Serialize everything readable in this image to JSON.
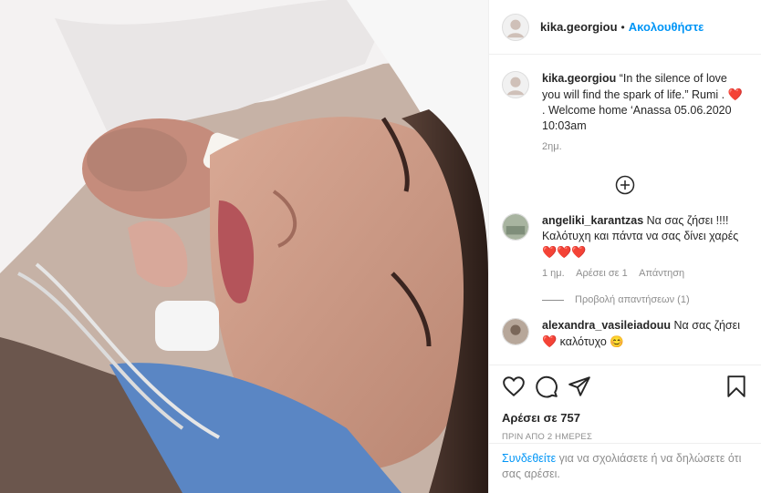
{
  "post": {
    "username": "kika.georgiou",
    "separator": "•",
    "follow_label": "Ακολουθήστε"
  },
  "caption": {
    "username": "kika.georgiou",
    "text": "“In the silence of love you will find the spark of life.” Rumi .",
    "heart": "❤️",
    "text2": ". Welcome home ‘Anassa",
    "datetime": "05.06.2020 10:03am",
    "age": "2ημ."
  },
  "comments": [
    {
      "username": "angeliki_karantzas",
      "text": "Να σας ζήσει !!!! Καλότυχη και πάντα να σας δίνει χαρές",
      "hearts": "❤️❤️❤️",
      "age": "1 ημ.",
      "likes_label": "Αρέσει σε 1",
      "reply_label": "Απάντηση",
      "view_replies": "Προβολή απαντήσεων (1)"
    },
    {
      "username": "alexandra_vasileiadouu",
      "text": "Να σας ζήσει",
      "heart": "❤️",
      "text2": "καλότυχο",
      "emoji": "😊"
    }
  ],
  "actions": {
    "likes_text": "Αρέσει σε 757",
    "timestamp": "ΠΡΙΝ ΑΠΟ 2 ΗΜΕΡΕΣ"
  },
  "footer": {
    "login_link": "Συνδεθείτε",
    "rest": " για να σχολιάσετε ή να δηλώσετε ότι σας αρέσει."
  },
  "colors": {
    "link": "#0095f6",
    "heart": "#e0101e",
    "muted": "#8e8e8e"
  },
  "icons": [
    "plus-circle-icon",
    "like-icon",
    "comment-icon",
    "share-icon",
    "bookmark-icon"
  ]
}
